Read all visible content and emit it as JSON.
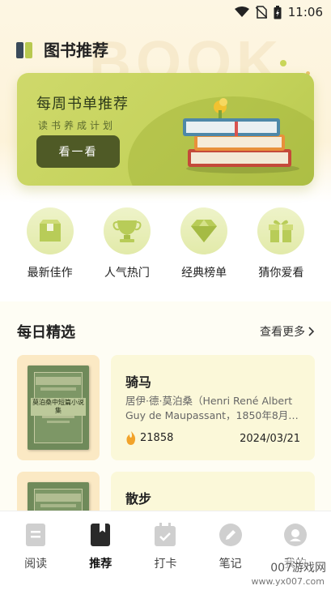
{
  "status_bar": {
    "time": "11:06"
  },
  "header": {
    "title": "图书推荐"
  },
  "background": {
    "watermark": "BOOK"
  },
  "banner": {
    "title": "每周书单推荐",
    "subtitle": "读书养成计划",
    "button_label": "看一看"
  },
  "categories": [
    {
      "label": "最新佳作",
      "icon": "box-icon"
    },
    {
      "label": "人气热门",
      "icon": "trophy-cup-icon"
    },
    {
      "label": "经典榜单",
      "icon": "diamond-icon"
    },
    {
      "label": "猜你爱看",
      "icon": "gift-icon"
    }
  ],
  "daily": {
    "title": "每日精选",
    "more_label": "查看更多",
    "books": [
      {
        "title": "骑马",
        "author": "居伊·德·莫泊桑（Henri René Albert Guy de Maupassant，1850年8月…",
        "heat": "21858",
        "date": "2024/03/21",
        "cover_title": "莫泊桑中短篇小说集"
      },
      {
        "title": "散步",
        "author": "",
        "heat": "",
        "date": "",
        "cover_title": ""
      }
    ]
  },
  "tabs": [
    {
      "label": "阅读",
      "active": false
    },
    {
      "label": "推荐",
      "active": true
    },
    {
      "label": "打卡",
      "active": false
    },
    {
      "label": "笔记",
      "active": false
    },
    {
      "label": "我的",
      "active": false
    }
  ],
  "overlay": {
    "watermark": "007游戏网",
    "url": "www.yx007.com"
  },
  "colors": {
    "accent": "#c4d25b",
    "button": "#4f5a26",
    "card_bg": "#fbf8d9",
    "cover_bg": "#fbe9c4"
  }
}
